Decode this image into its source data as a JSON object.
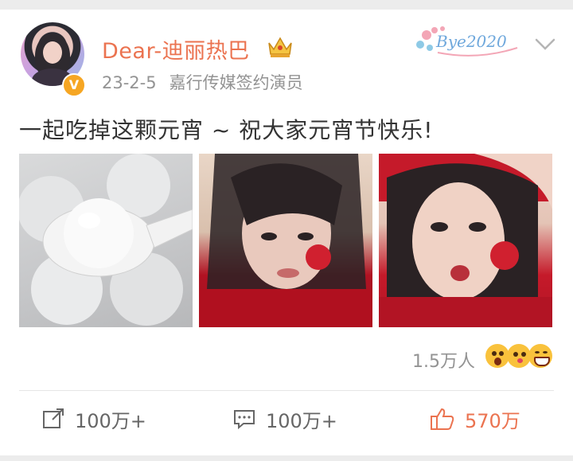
{
  "post": {
    "username": "Dear-迪丽热巴",
    "date": "23-2-5",
    "tagline": "嘉行传媒签约演员",
    "text": "一起吃掉这颗元宵 ~ 祝大家元宵节快乐!",
    "badge": "Bye2020",
    "verified_mark": "V",
    "images": [
      {
        "alt": "tangyuan-photo"
      },
      {
        "alt": "selfie-photo-1"
      },
      {
        "alt": "selfie-photo-2"
      }
    ]
  },
  "reactions": {
    "count": "1.5万人",
    "emojis": [
      "shocked-emoji-icon",
      "kiss-emoji-icon",
      "grin-emoji-icon"
    ]
  },
  "actions": {
    "repost": "100万+",
    "comment": "100万+",
    "like": "570万"
  },
  "colors": {
    "accent": "#eb7350",
    "meta": "#939393",
    "text": "#333333",
    "verified": "#f6a623"
  },
  "icons": {
    "repost": "share-icon",
    "comment": "comment-icon",
    "like": "thumbs-up-icon",
    "menu": "chevron-down-icon",
    "crown": "crown-icon"
  }
}
